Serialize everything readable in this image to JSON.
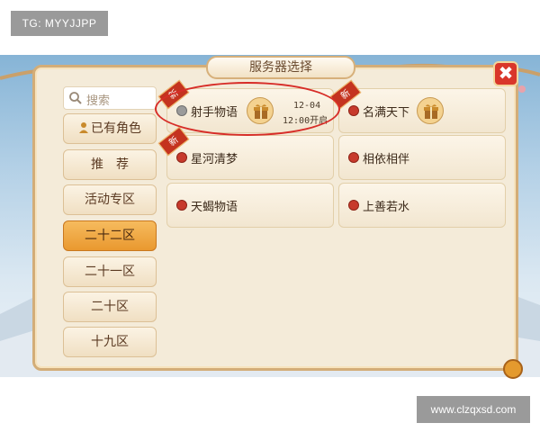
{
  "watermarks": {
    "top_left": "TG: MYYJJPP",
    "bottom_right": "www.clzqxsd.com"
  },
  "dialog": {
    "title": "服务器选择",
    "close_icon": "✖"
  },
  "search": {
    "placeholder": "搜索",
    "icon": "search-icon"
  },
  "tabs": [
    {
      "label": "已有角色",
      "icon": "person-icon"
    },
    {
      "label": "推　荐"
    },
    {
      "label": "活动专区"
    },
    {
      "label": "二十二区",
      "selected": true
    },
    {
      "label": "二十一区"
    },
    {
      "label": "二十区"
    },
    {
      "label": "十九区"
    }
  ],
  "servers": [
    {
      "name": "射手物语",
      "status": "gray",
      "new": true,
      "gift": true,
      "open_date": "12-04",
      "open_time": "12:00开启"
    },
    {
      "name": "名满天下",
      "status": "red",
      "new": true,
      "gift": true
    },
    {
      "name": "星河清梦",
      "status": "red",
      "new": true
    },
    {
      "name": "相依相伴",
      "status": "red"
    },
    {
      "name": "天蝎物语",
      "status": "red"
    },
    {
      "name": "上善若水",
      "status": "red"
    }
  ],
  "badges": {
    "new_label": "新"
  },
  "colors": {
    "accent": "#e9982f",
    "status_red": "#c73a2c",
    "status_gray": "#9b9b9b",
    "highlight": "#d72d28"
  }
}
